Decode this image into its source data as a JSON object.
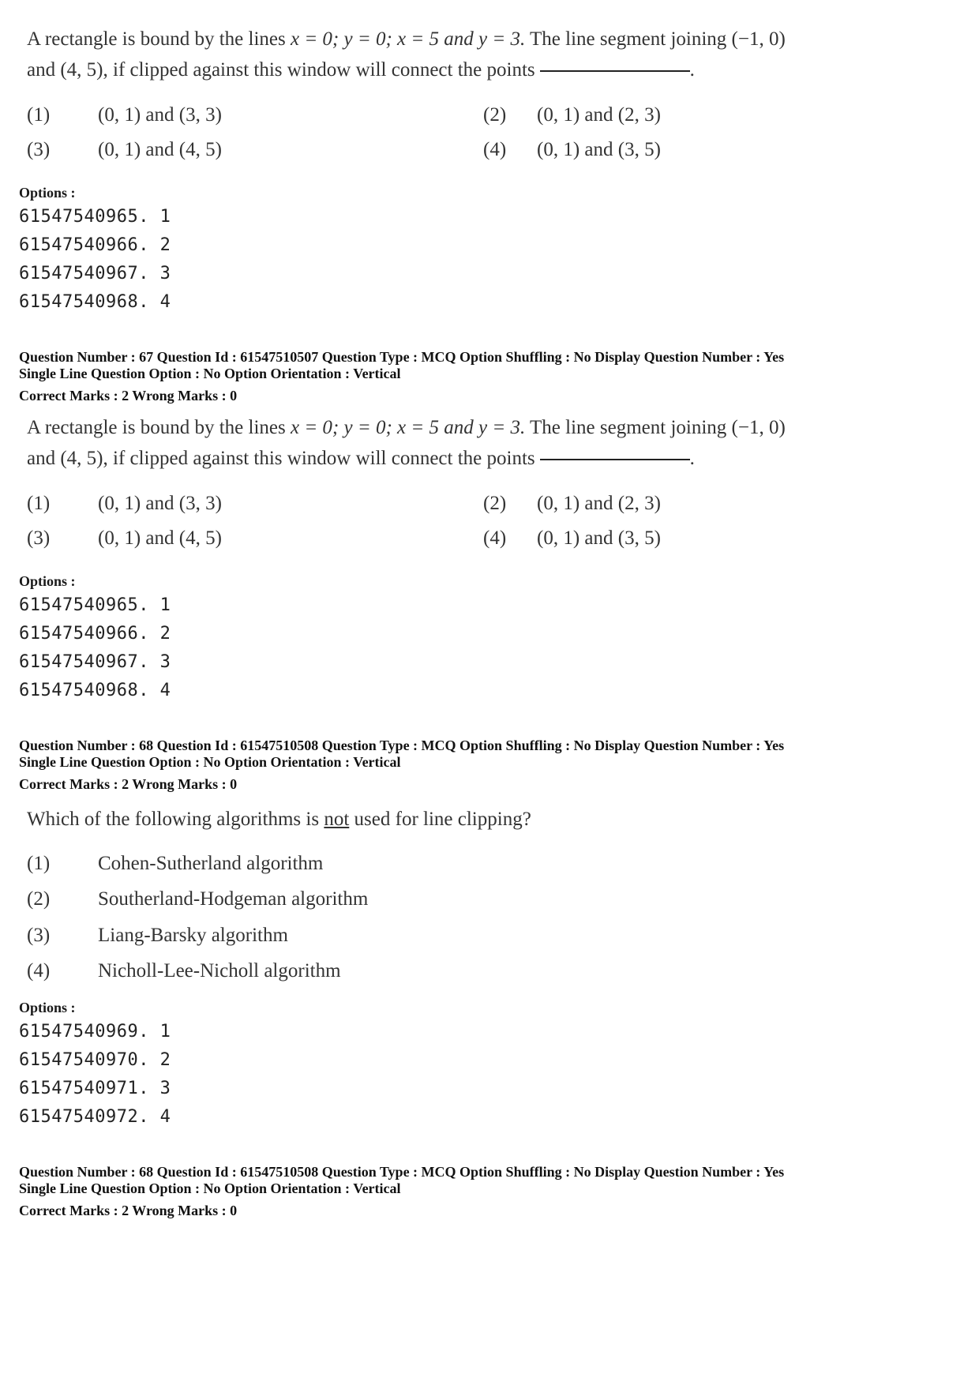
{
  "blocks": [
    {
      "question_text_part1": "A rectangle is bound by the lines ",
      "question_math": "x = 0; y = 0; x = 5 and y = 3.",
      "question_text_part2": " The line segment joining (−1, 0)",
      "question_text_line2": "and (4, 5), if clipped against this window will connect the points",
      "choices": [
        {
          "num": "(1)",
          "text": "(0, 1) and (3, 3)"
        },
        {
          "num": "(2)",
          "text": "(0, 1) and (2, 3)"
        },
        {
          "num": "(3)",
          "text": "(0, 1) and (4, 5)"
        },
        {
          "num": "(4)",
          "text": "(0, 1) and (3, 5)"
        }
      ],
      "options_label": "Options :",
      "option_ids": [
        "61547540965. 1",
        "61547540966. 2",
        "61547540967. 3",
        "61547540968. 4"
      ]
    },
    {
      "meta_line1": "Question Number : 67  Question Id : 61547510507  Question Type : MCQ  Option Shuffling : No  Display Question Number : Yes",
      "meta_line2": "Single Line Question Option : No  Option Orientation : Vertical",
      "meta_line3": "Correct Marks : 2  Wrong Marks : 0",
      "question_text_part1": "A rectangle is bound by the lines ",
      "question_math": "x = 0; y = 0; x = 5 and y = 3.",
      "question_text_part2": " The line segment joining (−1, 0)",
      "question_text_line2": "and (4, 5), if clipped against this window will connect the points",
      "choices": [
        {
          "num": "(1)",
          "text": "(0, 1) and (3, 3)"
        },
        {
          "num": "(2)",
          "text": "(0, 1) and (2, 3)"
        },
        {
          "num": "(3)",
          "text": "(0, 1) and (4, 5)"
        },
        {
          "num": "(4)",
          "text": "(0, 1) and (3, 5)"
        }
      ],
      "options_label": "Options :",
      "option_ids": [
        "61547540965. 1",
        "61547540966. 2",
        "61547540967. 3",
        "61547540968. 4"
      ]
    },
    {
      "meta_line1": "Question Number : 68  Question Id : 61547510508  Question Type : MCQ  Option Shuffling : No  Display Question Number : Yes",
      "meta_line2": "Single Line Question Option : No  Option Orientation : Vertical",
      "meta_line3": "Correct Marks : 2  Wrong Marks : 0",
      "question_pre": "Which of the following algorithms is ",
      "question_underlined": "not",
      "question_post": " used for line clipping?",
      "choices": [
        {
          "num": "(1)",
          "text": "Cohen-Sutherland algorithm"
        },
        {
          "num": "(2)",
          "text": "Southerland-Hodgeman algorithm"
        },
        {
          "num": "(3)",
          "text": "Liang-Barsky algorithm"
        },
        {
          "num": "(4)",
          "text": "Nicholl-Lee-Nicholl algorithm"
        }
      ],
      "options_label": "Options :",
      "option_ids": [
        "61547540969. 1",
        "61547540970. 2",
        "61547540971. 3",
        "61547540972. 4"
      ]
    },
    {
      "meta_line1": "Question Number : 68  Question Id : 61547510508  Question Type : MCQ  Option Shuffling : No  Display Question Number : Yes",
      "meta_line2": "Single Line Question Option : No  Option Orientation : Vertical",
      "meta_line3": "Correct Marks : 2  Wrong Marks : 0"
    }
  ]
}
